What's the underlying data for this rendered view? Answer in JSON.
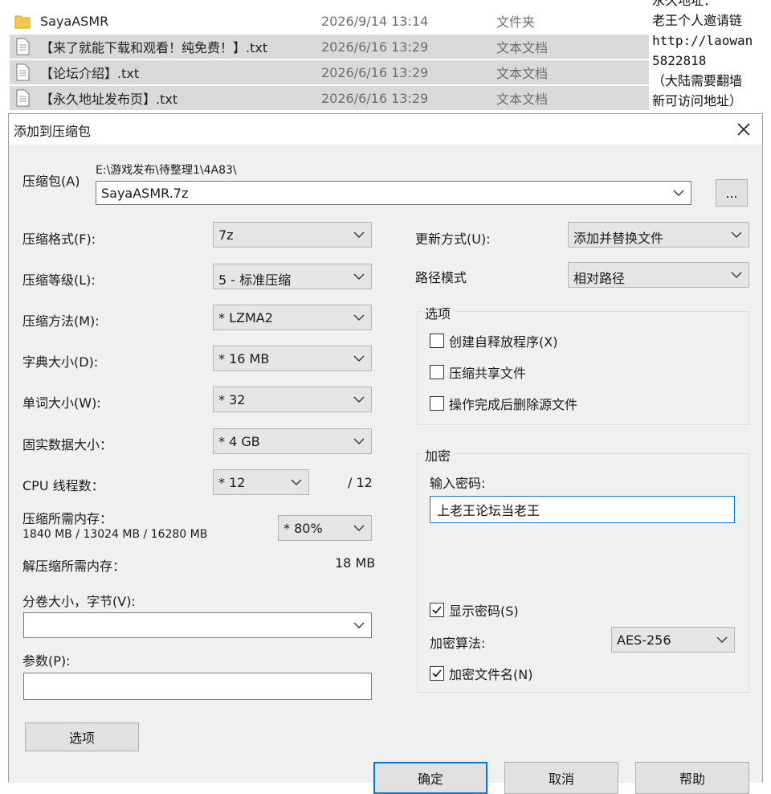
{
  "explorer": {
    "files": [
      {
        "name": "SayaASMR",
        "date": "2026/9/14 13:14",
        "type": "文件夹",
        "icon": "folder-icon"
      },
      {
        "name": "【来了就能下载和观看！纯免费！】.txt",
        "date": "2026/6/16 13:29",
        "type": "文本文档",
        "icon": "text-file-icon"
      },
      {
        "name": "【论坛介绍】.txt",
        "date": "2026/6/16 13:29",
        "type": "文本文档",
        "icon": "text-file-icon"
      },
      {
        "name": "【永久地址发布页】.txt",
        "date": "2026/6/16 13:29",
        "type": "文本文档",
        "icon": "text-file-icon"
      }
    ],
    "side_note_lines": [
      "永久地址：",
      "老王个人邀请链",
      "http://laowan",
      "5822818",
      "（大陆需要翻墙",
      "新可访问地址）"
    ]
  },
  "dialog": {
    "title": "添加到压缩包",
    "archive_label": "压缩包(A)",
    "archive_path": "E:\\游戏发布\\待整理1\\4A83\\",
    "archive_name": "SayaASMR.7z",
    "browse_label": "...",
    "format_label": "压缩格式(F):",
    "format_value": "7z",
    "level_label": "压缩等级(L):",
    "level_value": "5 - 标准压缩",
    "method_label": "压缩方法(M):",
    "method_value": "* LZMA2",
    "dict_label": "字典大小(D):",
    "dict_value": "* 16 MB",
    "word_label": "单词大小(W):",
    "word_value": "* 32",
    "solid_label": "固实数据大小：",
    "solid_value": "* 4 GB",
    "threads_label": "CPU 线程数：",
    "threads_value": "* 12",
    "threads_max": "/ 12",
    "mem_comp_label": "压缩所需内存：",
    "mem_comp_detail": "1840 MB / 13024 MB / 16280 MB",
    "mem_percent": "* 80%",
    "mem_decomp_label": "解压缩所需内存：",
    "mem_decomp_value": "18 MB",
    "volume_label": "分卷大小，字节(V):",
    "volume_value": "",
    "params_label": "参数(P):",
    "params_value": "",
    "options_button": "选项",
    "update_label": "更新方式(U):",
    "update_value": "添加并替换文件",
    "path_label": "路径模式",
    "path_value": "相对路径",
    "options_group": "选项",
    "sfx_label": "创建自释放程序(X)",
    "sfx_checked": false,
    "shared_label": "压缩共享文件",
    "shared_checked": false,
    "delete_label": "操作完成后删除源文件",
    "delete_checked": false,
    "encrypt_group": "加密",
    "password_label": "输入密码:",
    "password_value": "上老王论坛当老王",
    "show_pwd_label": "显示密码(S)",
    "show_pwd_checked": true,
    "enc_method_label": "加密算法:",
    "enc_method_value": "AES-256",
    "enc_names_label": "加密文件名(N)",
    "enc_names_checked": true,
    "ok": "确定",
    "cancel": "取消",
    "help": "帮助"
  },
  "colors": {
    "selection": "#d9d9d9",
    "accent": "#0078d7",
    "client_bg": "#f0f0f0"
  }
}
